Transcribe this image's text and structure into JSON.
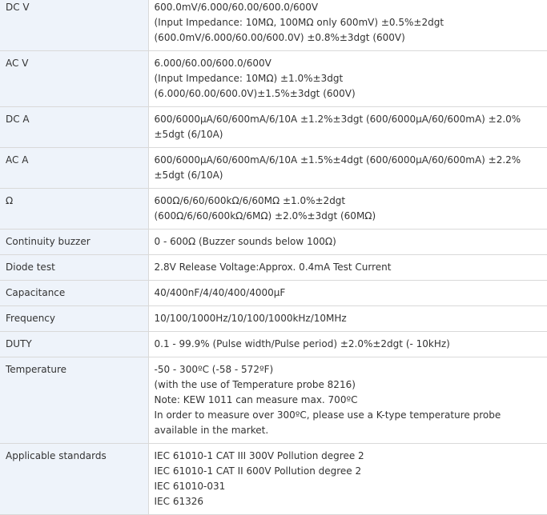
{
  "rows": [
    {
      "label": "DC V",
      "lines": [
        "600.0mV/6.000/60.00/600.0/600V",
        "(Input Impedance: 10MΩ, 100MΩ only 600mV) ±0.5%±2dgt",
        "(600.0mV/6.000/60.00/600.0V) ±0.8%±3dgt (600V)"
      ]
    },
    {
      "label": "AC V",
      "lines": [
        "6.000/60.00/600.0/600V",
        "(Input Impedance: 10MΩ) ±1.0%±3dgt",
        "(6.000/60.00/600.0V)±1.5%±3dgt (600V)"
      ]
    },
    {
      "label": "DC A",
      "lines": [
        "600/6000µA/60/600mA/6/10A ±1.2%±3dgt (600/6000µA/60/600mA) ±2.0% ±5dgt (6/10A)"
      ]
    },
    {
      "label": "AC A",
      "lines": [
        "600/6000µA/60/600mA/6/10A ±1.5%±4dgt (600/6000µA/60/600mA) ±2.2% ±5dgt (6/10A)"
      ]
    },
    {
      "label": "Ω",
      "lines": [
        "600Ω/6/60/600kΩ/6/60MΩ ±1.0%±2dgt",
        "(600Ω/6/60/600kΩ/6MΩ) ±2.0%±3dgt (60MΩ)"
      ]
    },
    {
      "label": "Continuity buzzer",
      "lines": [
        "0 - 600Ω (Buzzer sounds below 100Ω)"
      ]
    },
    {
      "label": "Diode test",
      "lines": [
        "2.8V Release Voltage:Approx. 0.4mA Test Current"
      ]
    },
    {
      "label": "Capacitance",
      "lines": [
        "40/400nF/4/40/400/4000µF"
      ]
    },
    {
      "label": "Frequency",
      "lines": [
        "10/100/1000Hz/10/100/1000kHz/10MHz"
      ]
    },
    {
      "label": "DUTY",
      "lines": [
        "0.1 - 99.9% (Pulse width/Pulse period) ±2.0%±2dgt (- 10kHz)"
      ]
    },
    {
      "label": "Temperature",
      "lines": [
        "-50 - 300ºC (-58 - 572ºF)",
        "(with the use of Temperature probe 8216)",
        "Note: KEW 1011 can measure max. 700ºC",
        "In order to measure over 300ºC, please use a K-type temperature probe available in the market."
      ]
    },
    {
      "label": "Applicable standards",
      "lines": [
        "IEC 61010-1 CAT III 300V Pollution degree 2",
        "IEC 61010-1 CAT II 600V Pollution degree 2",
        "IEC 61010-031",
        "IEC 61326"
      ]
    }
  ]
}
